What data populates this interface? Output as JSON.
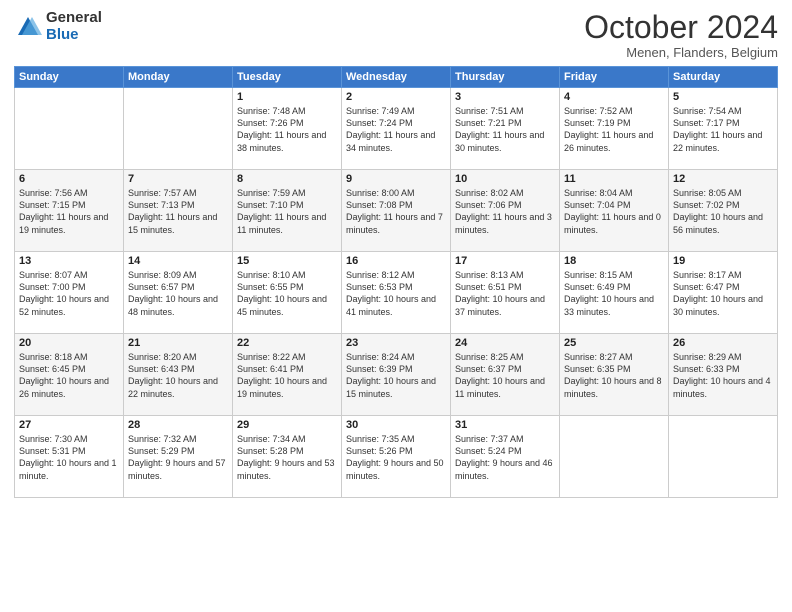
{
  "logo": {
    "general": "General",
    "blue": "Blue"
  },
  "header": {
    "month": "October 2024",
    "location": "Menen, Flanders, Belgium"
  },
  "weekdays": [
    "Sunday",
    "Monday",
    "Tuesday",
    "Wednesday",
    "Thursday",
    "Friday",
    "Saturday"
  ],
  "weeks": [
    [
      {
        "day": "",
        "info": ""
      },
      {
        "day": "",
        "info": ""
      },
      {
        "day": "1",
        "info": "Sunrise: 7:48 AM\nSunset: 7:26 PM\nDaylight: 11 hours and 38 minutes."
      },
      {
        "day": "2",
        "info": "Sunrise: 7:49 AM\nSunset: 7:24 PM\nDaylight: 11 hours and 34 minutes."
      },
      {
        "day": "3",
        "info": "Sunrise: 7:51 AM\nSunset: 7:21 PM\nDaylight: 11 hours and 30 minutes."
      },
      {
        "day": "4",
        "info": "Sunrise: 7:52 AM\nSunset: 7:19 PM\nDaylight: 11 hours and 26 minutes."
      },
      {
        "day": "5",
        "info": "Sunrise: 7:54 AM\nSunset: 7:17 PM\nDaylight: 11 hours and 22 minutes."
      }
    ],
    [
      {
        "day": "6",
        "info": "Sunrise: 7:56 AM\nSunset: 7:15 PM\nDaylight: 11 hours and 19 minutes."
      },
      {
        "day": "7",
        "info": "Sunrise: 7:57 AM\nSunset: 7:13 PM\nDaylight: 11 hours and 15 minutes."
      },
      {
        "day": "8",
        "info": "Sunrise: 7:59 AM\nSunset: 7:10 PM\nDaylight: 11 hours and 11 minutes."
      },
      {
        "day": "9",
        "info": "Sunrise: 8:00 AM\nSunset: 7:08 PM\nDaylight: 11 hours and 7 minutes."
      },
      {
        "day": "10",
        "info": "Sunrise: 8:02 AM\nSunset: 7:06 PM\nDaylight: 11 hours and 3 minutes."
      },
      {
        "day": "11",
        "info": "Sunrise: 8:04 AM\nSunset: 7:04 PM\nDaylight: 11 hours and 0 minutes."
      },
      {
        "day": "12",
        "info": "Sunrise: 8:05 AM\nSunset: 7:02 PM\nDaylight: 10 hours and 56 minutes."
      }
    ],
    [
      {
        "day": "13",
        "info": "Sunrise: 8:07 AM\nSunset: 7:00 PM\nDaylight: 10 hours and 52 minutes."
      },
      {
        "day": "14",
        "info": "Sunrise: 8:09 AM\nSunset: 6:57 PM\nDaylight: 10 hours and 48 minutes."
      },
      {
        "day": "15",
        "info": "Sunrise: 8:10 AM\nSunset: 6:55 PM\nDaylight: 10 hours and 45 minutes."
      },
      {
        "day": "16",
        "info": "Sunrise: 8:12 AM\nSunset: 6:53 PM\nDaylight: 10 hours and 41 minutes."
      },
      {
        "day": "17",
        "info": "Sunrise: 8:13 AM\nSunset: 6:51 PM\nDaylight: 10 hours and 37 minutes."
      },
      {
        "day": "18",
        "info": "Sunrise: 8:15 AM\nSunset: 6:49 PM\nDaylight: 10 hours and 33 minutes."
      },
      {
        "day": "19",
        "info": "Sunrise: 8:17 AM\nSunset: 6:47 PM\nDaylight: 10 hours and 30 minutes."
      }
    ],
    [
      {
        "day": "20",
        "info": "Sunrise: 8:18 AM\nSunset: 6:45 PM\nDaylight: 10 hours and 26 minutes."
      },
      {
        "day": "21",
        "info": "Sunrise: 8:20 AM\nSunset: 6:43 PM\nDaylight: 10 hours and 22 minutes."
      },
      {
        "day": "22",
        "info": "Sunrise: 8:22 AM\nSunset: 6:41 PM\nDaylight: 10 hours and 19 minutes."
      },
      {
        "day": "23",
        "info": "Sunrise: 8:24 AM\nSunset: 6:39 PM\nDaylight: 10 hours and 15 minutes."
      },
      {
        "day": "24",
        "info": "Sunrise: 8:25 AM\nSunset: 6:37 PM\nDaylight: 10 hours and 11 minutes."
      },
      {
        "day": "25",
        "info": "Sunrise: 8:27 AM\nSunset: 6:35 PM\nDaylight: 10 hours and 8 minutes."
      },
      {
        "day": "26",
        "info": "Sunrise: 8:29 AM\nSunset: 6:33 PM\nDaylight: 10 hours and 4 minutes."
      }
    ],
    [
      {
        "day": "27",
        "info": "Sunrise: 7:30 AM\nSunset: 5:31 PM\nDaylight: 10 hours and 1 minute."
      },
      {
        "day": "28",
        "info": "Sunrise: 7:32 AM\nSunset: 5:29 PM\nDaylight: 9 hours and 57 minutes."
      },
      {
        "day": "29",
        "info": "Sunrise: 7:34 AM\nSunset: 5:28 PM\nDaylight: 9 hours and 53 minutes."
      },
      {
        "day": "30",
        "info": "Sunrise: 7:35 AM\nSunset: 5:26 PM\nDaylight: 9 hours and 50 minutes."
      },
      {
        "day": "31",
        "info": "Sunrise: 7:37 AM\nSunset: 5:24 PM\nDaylight: 9 hours and 46 minutes."
      },
      {
        "day": "",
        "info": ""
      },
      {
        "day": "",
        "info": ""
      }
    ]
  ]
}
